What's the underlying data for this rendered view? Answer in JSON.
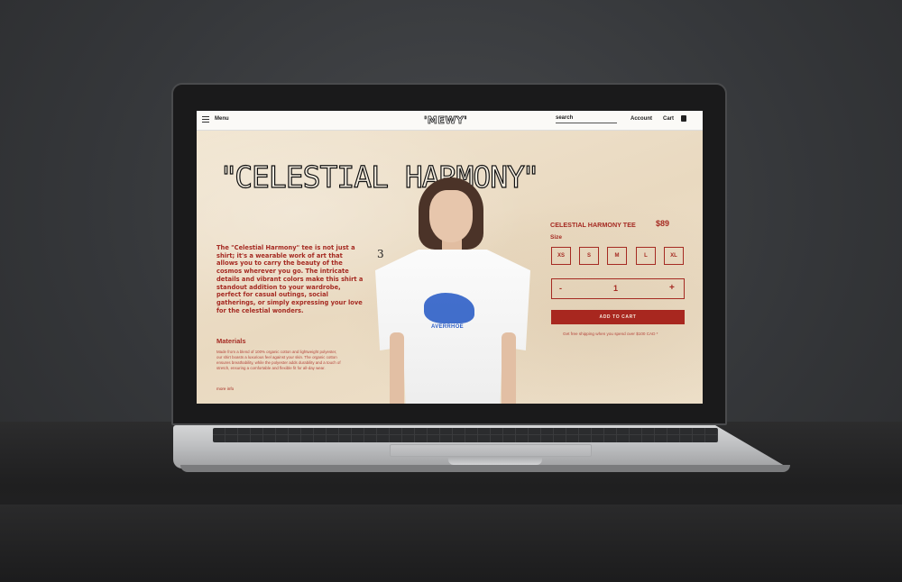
{
  "header": {
    "menu_label": "Menu",
    "logo": "'MEWY'",
    "search_label": "search",
    "account_label": "Account",
    "cart_label": "Cart"
  },
  "hero": {
    "title_open": "\"",
    "title": "CELESTIAL HARMONY",
    "title_close": "\"",
    "deco": "3"
  },
  "description": "The \"Celestial Harmony\" tee is not just a shirt; it's a wearable work of art that allows you to carry the beauty of the cosmos wherever you go. The intricate details and vibrant colors make this shirt a standout addition to your wardrobe, perfect for casual outings, social gatherings, or simply expressing your love for the celestial wonders.",
  "materials": {
    "title": "Materials",
    "text": "Made from a blend of 100% organic cotton and lightweight polyester, our shirt boasts a luxurious feel against your skin. The organic cotton ensures breathability, while the polyester adds durability and a touch of stretch, ensuring a comfortable and flexible fit for all-day wear.",
    "more_info": "more info"
  },
  "model": {
    "shirt_graphic_text": "AVERRHOE"
  },
  "product": {
    "name": "CELESTIAL HARMONY TEE",
    "price": "$89",
    "size_label": "Size",
    "sizes": [
      "XS",
      "S",
      "M",
      "L",
      "XL"
    ],
    "qty_minus": "-",
    "qty_value": "1",
    "qty_plus": "+",
    "add_to_cart": "ADD TO CART",
    "shipping_note": "Get free shipping when you spend over $100 CAD *"
  },
  "colors": {
    "accent": "#a52a22",
    "background": "#efe3cf"
  }
}
